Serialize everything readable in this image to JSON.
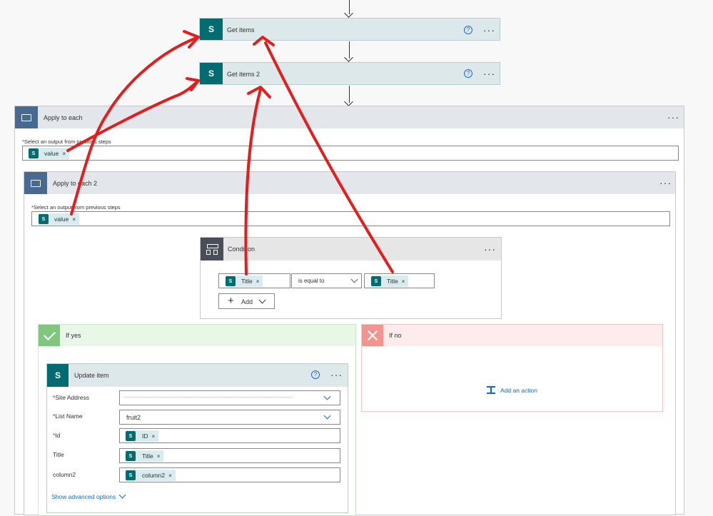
{
  "steps": {
    "get_items": {
      "title": "Get items"
    },
    "get_items_2": {
      "title": "Get items 2"
    }
  },
  "apply1": {
    "title": "Apply to each",
    "select_label": "Select an output from previous steps",
    "token": "value"
  },
  "apply2": {
    "title": "Apply to each 2",
    "select_label": "Select an output from previous steps",
    "token": "value"
  },
  "condition": {
    "title": "Condition",
    "left_token": "Title",
    "operator": "is equal to",
    "right_token": "Title",
    "add_label": "Add"
  },
  "yes_branch": {
    "title": "If yes"
  },
  "no_branch": {
    "title": "If no",
    "add_action": "Add an action"
  },
  "update": {
    "title": "Update item",
    "fields": {
      "site_label": "Site Address",
      "list_label": "List Name",
      "list_value": "fruit2",
      "id_label": "Id",
      "id_token": "ID",
      "title_label": "Title",
      "title_token": "Title",
      "col_label": "column2",
      "col_token": "column2"
    },
    "advanced": "Show advanced options"
  },
  "glyphs": {
    "close": "×",
    "help": "?",
    "more": "···",
    "sp": "S",
    "required": "*",
    "plus": "+"
  },
  "colors": {
    "sharepoint": "#036c70",
    "loop": "#486991",
    "condition": "#484f58",
    "yes": "#7fc77f",
    "no": "#f3948f",
    "annotation": "#e21f1f"
  }
}
